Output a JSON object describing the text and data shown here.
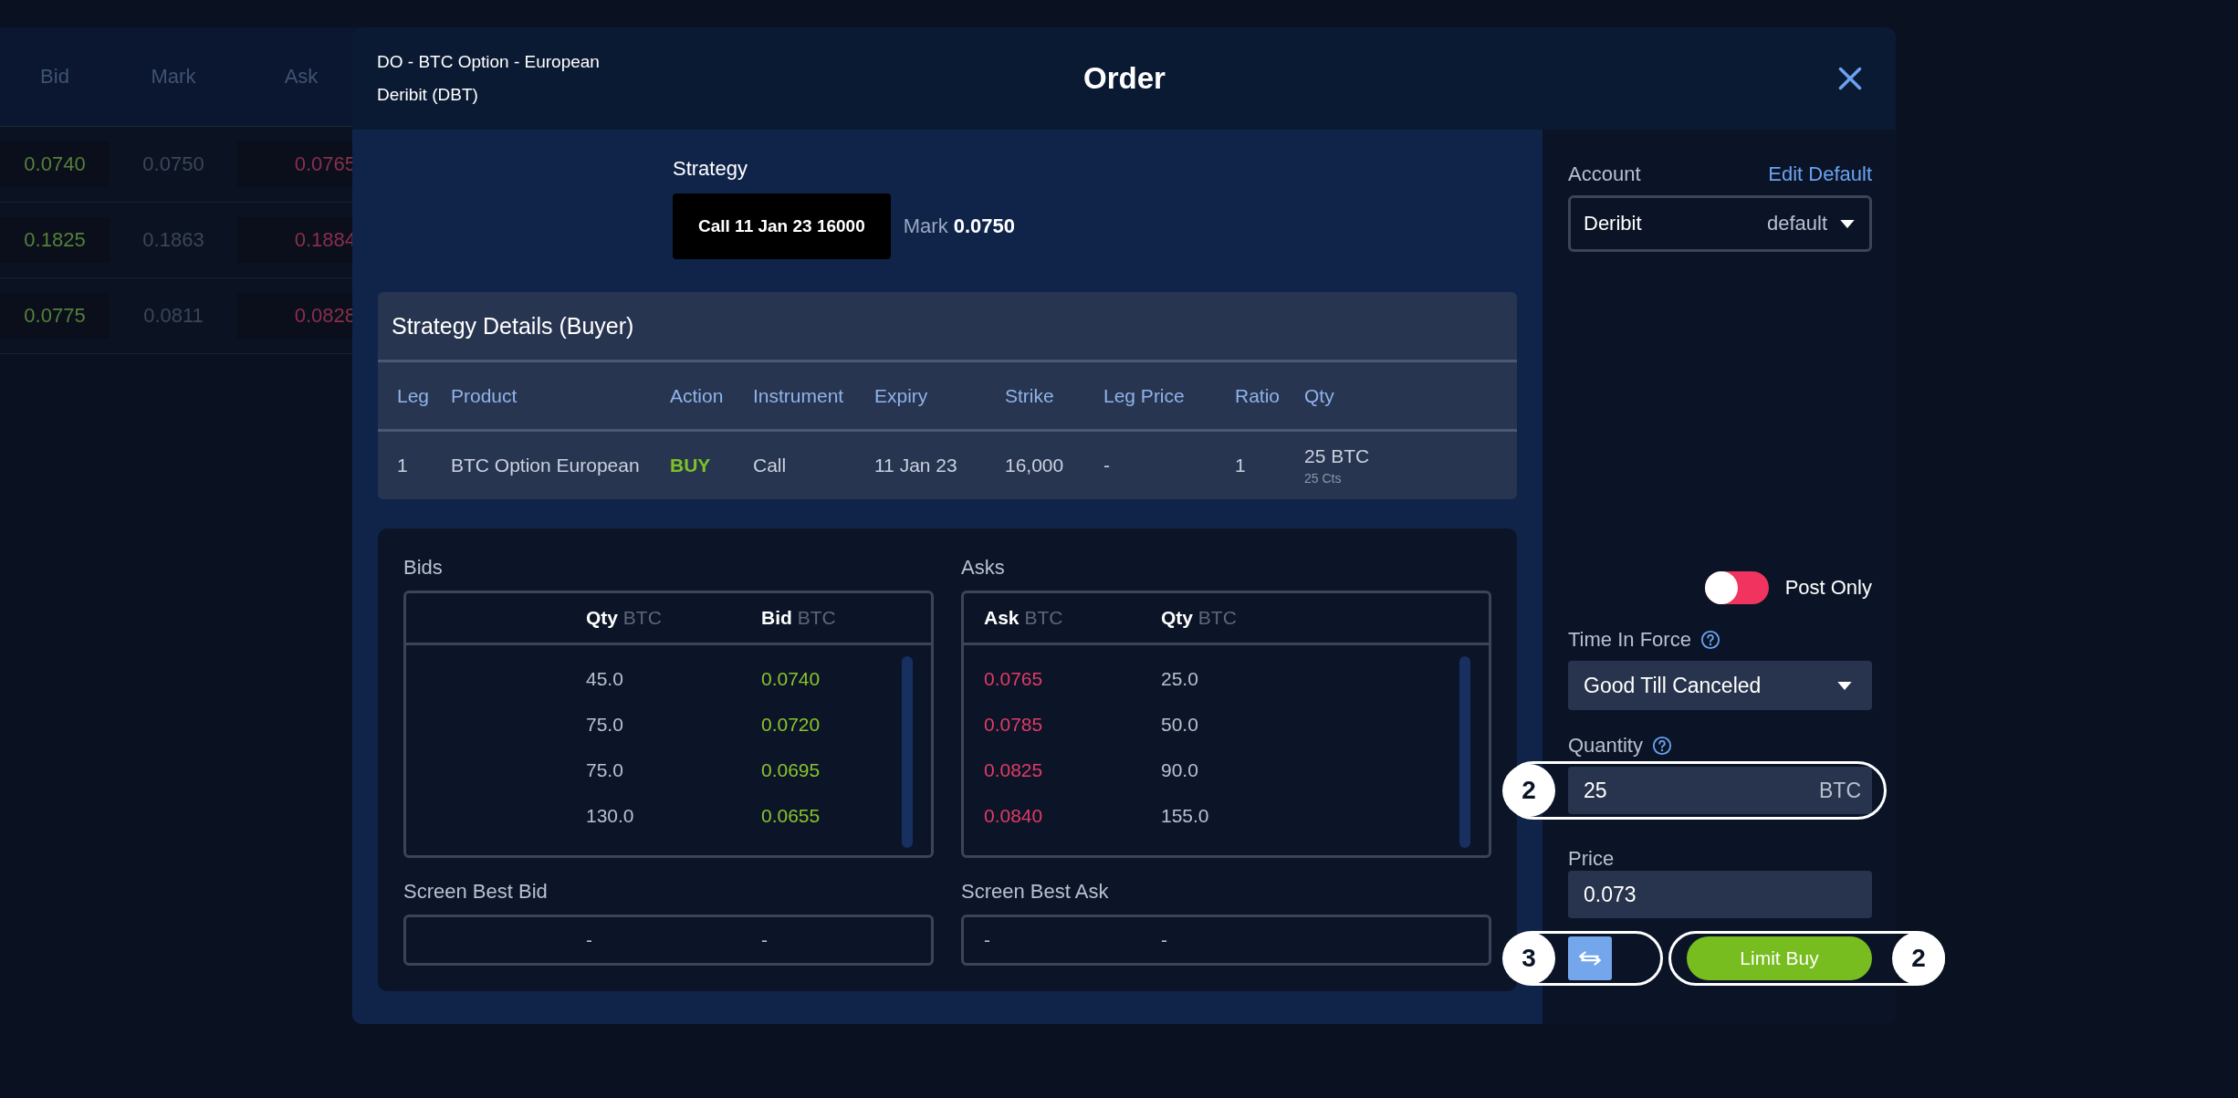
{
  "background_table": {
    "columns": [
      "Bid",
      "Mark",
      "Ask"
    ],
    "rows": [
      {
        "bid": "0.0740",
        "mark": "0.0750",
        "ask": "0.0765"
      },
      {
        "bid": "0.1825",
        "mark": "0.1863",
        "ask": "0.1884"
      },
      {
        "bid": "0.0775",
        "mark": "0.0811",
        "ask": "0.0828"
      }
    ]
  },
  "order_dialog": {
    "instrument": "DO - BTC Option - European",
    "venue": "Deribit (DBT)",
    "title": "Order",
    "strategy": {
      "label": "Strategy",
      "chip": "Call 11 Jan 23 16000",
      "mark_label": "Mark",
      "mark_value": "0.0750"
    },
    "strategy_details": {
      "title": "Strategy Details (Buyer)",
      "columns": [
        "Leg",
        "Product",
        "Action",
        "Instrument",
        "Expiry",
        "Strike",
        "Leg Price",
        "Ratio",
        "Qty"
      ],
      "rows": [
        {
          "leg": "1",
          "product": "BTC Option European",
          "action": "BUY",
          "kind": "buy",
          "instrument": "Call",
          "expiry": "11 Jan 23",
          "strike": "16,000",
          "leg_price": "-",
          "ratio": "1",
          "qty": "25 BTC",
          "qty_sub": "25 Cts"
        }
      ]
    },
    "bids": {
      "title": "Bids",
      "columns": [
        {
          "label": "Qty",
          "unit": "BTC"
        },
        {
          "label": "Bid",
          "unit": "BTC"
        }
      ],
      "rows": [
        {
          "qty": "45.0",
          "price": "0.0740"
        },
        {
          "qty": "75.0",
          "price": "0.0720"
        },
        {
          "qty": "75.0",
          "price": "0.0695"
        },
        {
          "qty": "130.0",
          "price": "0.0655"
        }
      ]
    },
    "asks": {
      "title": "Asks",
      "columns": [
        {
          "label": "Ask",
          "unit": "BTC"
        },
        {
          "label": "Qty",
          "unit": "BTC"
        }
      ],
      "rows": [
        {
          "price": "0.0765",
          "qty": "25.0"
        },
        {
          "price": "0.0785",
          "qty": "50.0"
        },
        {
          "price": "0.0825",
          "qty": "90.0"
        },
        {
          "price": "0.0840",
          "qty": "155.0"
        }
      ]
    },
    "screen_best_bid": {
      "label": "Screen Best Bid",
      "values": [
        "-",
        "-"
      ]
    },
    "screen_best_ask": {
      "label": "Screen Best Ask",
      "values": [
        "-",
        "-"
      ]
    },
    "account": {
      "label": "Account",
      "link": "Edit Default",
      "name": "Deribit",
      "value": "default"
    },
    "post_only": {
      "label": "Post Only",
      "on": false
    },
    "time_in_force": {
      "label": "Time In Force",
      "value": "Good Till Canceled"
    },
    "quantity": {
      "label": "Quantity",
      "value": "25",
      "unit": "BTC"
    },
    "price": {
      "label": "Price",
      "value": "0.073"
    },
    "submit_button": "Limit Buy"
  },
  "callouts": [
    {
      "number": "2",
      "kind": "quantity"
    },
    {
      "number": "3",
      "kind": "swap"
    },
    {
      "number": "2",
      "kind": "submit"
    }
  ]
}
